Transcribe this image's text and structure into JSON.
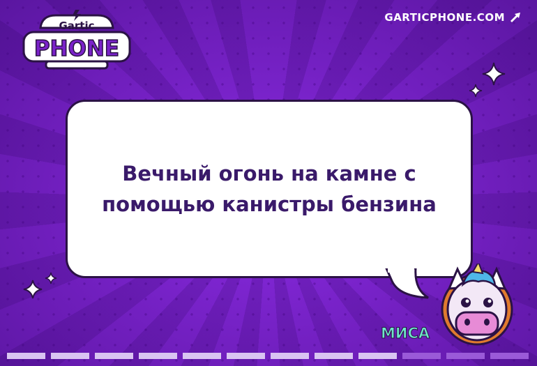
{
  "logo": {
    "top_word": "Gartic",
    "main_word": "PHONE",
    "icon": "lightning-icon"
  },
  "site": {
    "label": "GARTICPHONE.COM",
    "icon": "pencil-arrow-icon"
  },
  "prompt": {
    "line1": "Вечный огонь на камне с",
    "line2": "помощью канистры бензина"
  },
  "player": {
    "name": "МИСА",
    "avatar": "unicorn-avatar"
  },
  "progress": {
    "completed": 9,
    "total": 12
  },
  "colors": {
    "background": "#7a22c9",
    "text": "#3a1a6a",
    "name": "#6ee6c8"
  }
}
